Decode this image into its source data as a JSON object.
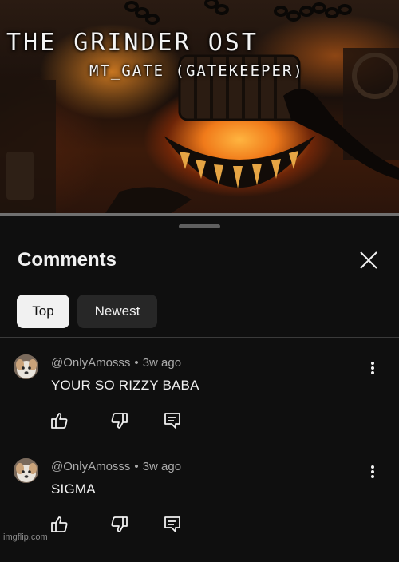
{
  "video": {
    "title": "THE GRINDER OST",
    "subtitle": "MT_GATE (GATEKEEPER)"
  },
  "comments_panel": {
    "heading": "Comments",
    "close_icon": "close-icon",
    "sort_chips": [
      {
        "label": "Top",
        "selected": true
      },
      {
        "label": "Newest",
        "selected": false
      }
    ]
  },
  "comments": [
    {
      "author": "@OnlyAmosss",
      "separator": "•",
      "age": "3w ago",
      "text": "YOUR SO RIZZY BABA",
      "icons": [
        "avatar",
        "more-vert-icon",
        "thumb-up-icon",
        "thumb-down-icon",
        "reply-icon"
      ]
    },
    {
      "author": "@OnlyAmosss",
      "separator": "•",
      "age": "3w ago",
      "text": "SIGMA",
      "icons": [
        "avatar",
        "more-vert-icon",
        "thumb-up-icon",
        "thumb-down-icon",
        "reply-icon"
      ]
    }
  ],
  "watermark": "imgflip.com",
  "colors": {
    "background": "#0f0f0f",
    "text": "#f1f1f1",
    "secondary_text": "#aaaaaa",
    "chip_selected_bg": "#f1f1f1",
    "chip_bg": "#272727"
  }
}
